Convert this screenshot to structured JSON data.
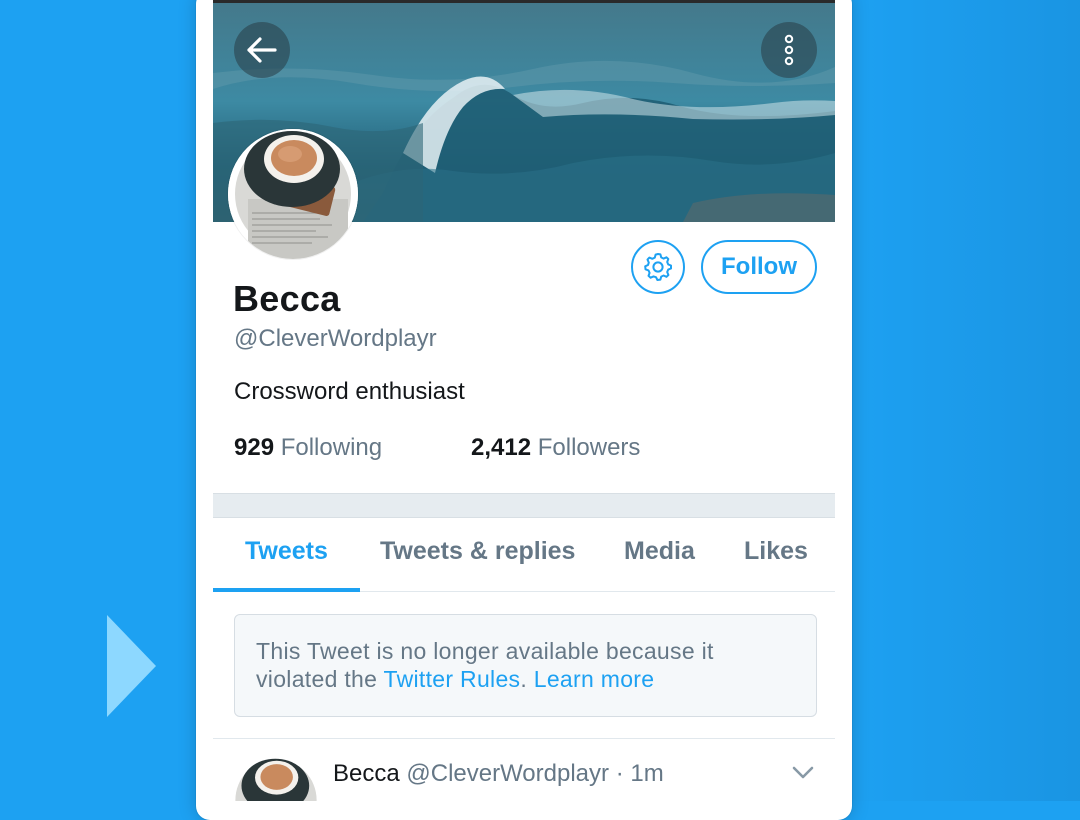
{
  "profile": {
    "name": "Becca",
    "handle": "@CleverWordplayr",
    "bio": "Crossword enthusiast",
    "following_count": "929",
    "following_label": "Following",
    "followers_count": "2,412",
    "followers_label": "Followers"
  },
  "actions": {
    "follow_label": "Follow"
  },
  "tabs": [
    {
      "label": "Tweets",
      "active": true
    },
    {
      "label": "Tweets & replies",
      "active": false
    },
    {
      "label": "Media",
      "active": false
    },
    {
      "label": "Likes",
      "active": false
    }
  ],
  "notice": {
    "text_before": "This Tweet is no longer available because it violated the ",
    "rules_link": "Twitter Rules",
    "separator": ". ",
    "learn_more": "Learn more"
  },
  "tweet": {
    "name": "Becca",
    "handle": "@CleverWordplayr",
    "separator": "·",
    "time": "1m"
  },
  "icons": {
    "back": "arrow-left-icon",
    "more": "more-vertical-icon",
    "settings": "gear-icon",
    "chevron": "chevron-down-icon",
    "play": "play-arrow-icon"
  },
  "colors": {
    "accent": "#1da1f2",
    "background": "#1da1f2",
    "secondary_text": "#657786",
    "primary_text": "#14171a",
    "play_arrow": "#8dd8ff"
  }
}
